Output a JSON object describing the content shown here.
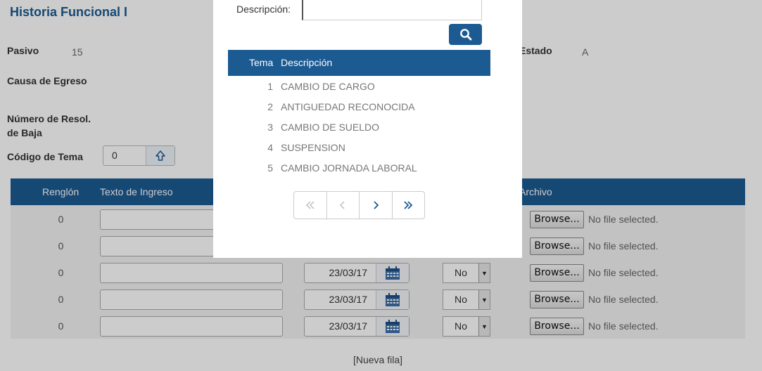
{
  "page": {
    "title": "Historia Funcional I",
    "pasivo": {
      "label": "Pasivo",
      "value": "15"
    },
    "estado": {
      "label": "Estado",
      "value": "A"
    },
    "causa_egreso": {
      "label": "Causa de Egreso"
    },
    "numero_resol": {
      "label_line1": "Número de Resol.",
      "label_line2": "de Baja"
    },
    "codigo_tema": {
      "label": "Código de Tema",
      "value": "0"
    }
  },
  "grid": {
    "headers": {
      "renglon": "Renglón",
      "texto": "Texto de Ingreso",
      "archivo": "Archivo"
    },
    "rows": [
      {
        "renglon": "0",
        "date": "",
        "select": "",
        "browse": "Browse...",
        "file": "No file selected."
      },
      {
        "renglon": "0",
        "date": "",
        "select": "",
        "browse": "Browse...",
        "file": "No file selected."
      },
      {
        "renglon": "0",
        "date": "23/03/17",
        "select": "No",
        "browse": "Browse...",
        "file": "No file selected."
      },
      {
        "renglon": "0",
        "date": "23/03/17",
        "select": "No",
        "browse": "Browse...",
        "file": "No file selected."
      },
      {
        "renglon": "0",
        "date": "23/03/17",
        "select": "No",
        "browse": "Browse...",
        "file": "No file selected."
      }
    ],
    "nueva_fila": "[Nueva fila]"
  },
  "modal": {
    "descripcion_label": "Descripción:",
    "descripcion_value": "",
    "table_headers": {
      "tema": "Tema",
      "descripcion": "Descripción"
    },
    "rows": [
      {
        "num": "1",
        "desc": "CAMBIO DE CARGO"
      },
      {
        "num": "2",
        "desc": "ANTIGUEDAD RECONOCIDA"
      },
      {
        "num": "3",
        "desc": "CAMBIO DE SUELDO"
      },
      {
        "num": "4",
        "desc": "SUSPENSION"
      },
      {
        "num": "5",
        "desc": "CAMBIO JORNADA LABORAL"
      }
    ]
  },
  "icons": {
    "search": "search-icon",
    "up_arrow": "arrow-up-icon",
    "calendar": "calendar-icon",
    "first": "double-chevron-left-icon",
    "prev": "chevron-left-icon",
    "next": "chevron-right-icon",
    "last": "double-chevron-right-icon"
  },
  "colors": {
    "primary": "#1c5a92"
  }
}
